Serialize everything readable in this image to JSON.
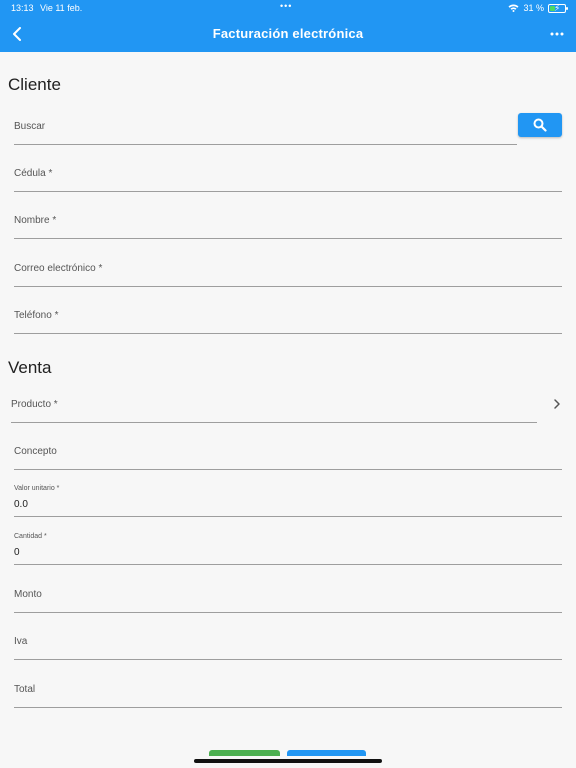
{
  "status_bar": {
    "time": "13:13",
    "date": "Vie 11 feb.",
    "dots": "•••",
    "battery": "31 %"
  },
  "app_bar": {
    "title": "Facturación electrónica",
    "back_icon": "chevron-left-icon",
    "more_icon": "more-horizontal-icon"
  },
  "cliente": {
    "title": "Cliente",
    "search_label": "Buscar",
    "search_button_icon": "search-icon",
    "cedula_label": "Cédula *",
    "nombre_label": "Nombre *",
    "correo_label": "Correo electrónico *",
    "telefono_label": "Teléfono *"
  },
  "venta": {
    "title": "Venta",
    "producto_label": "Producto *",
    "concepto_label": "Concepto",
    "valor_unitario_label": "Valor unitario *",
    "valor_unitario_value": "0.0",
    "cantidad_label": "Cantidad *",
    "cantidad_value": "0",
    "monto_label": "Monto",
    "iva_label": "Iva",
    "total_label": "Total"
  },
  "colors": {
    "primary": "#2196f3",
    "accent_green": "#4caf50",
    "background": "#f7f7f7"
  }
}
